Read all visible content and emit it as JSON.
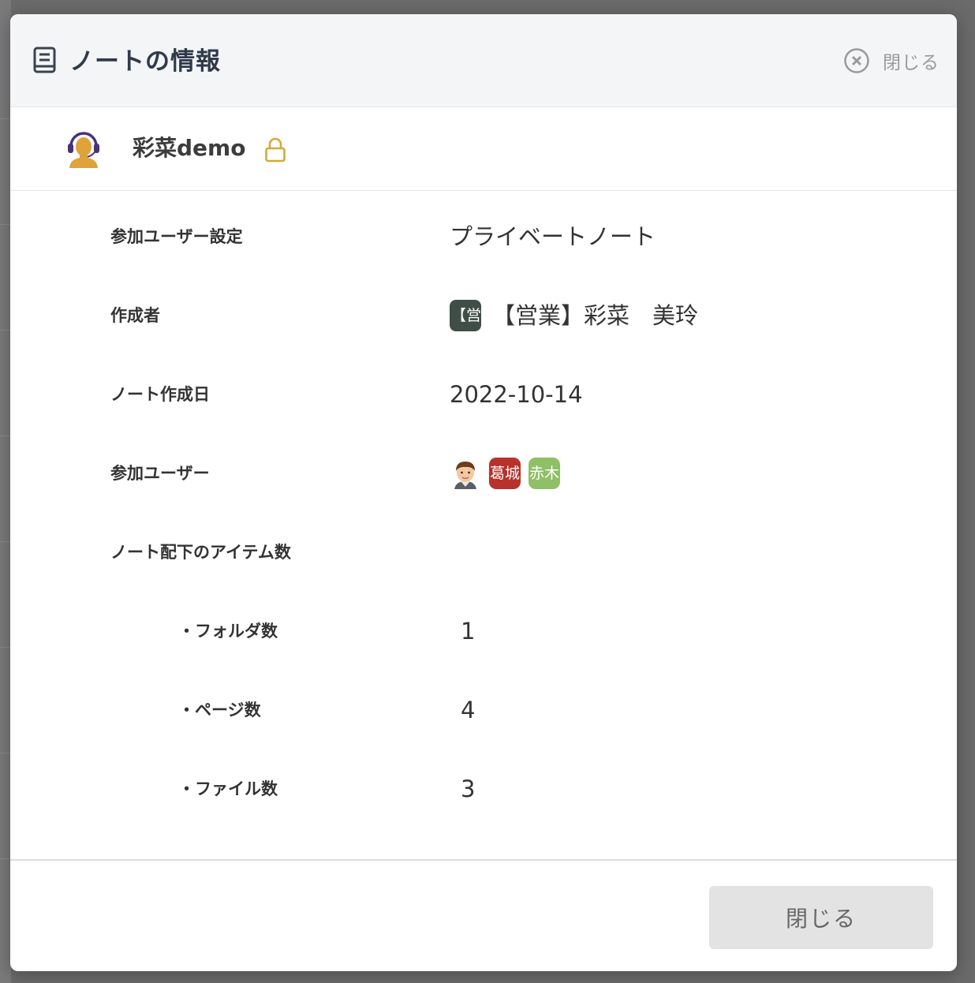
{
  "modal": {
    "title": "ノートの情報",
    "close_label": "閉じる",
    "footer_close_label": "閉じる"
  },
  "owner": {
    "name": "彩菜demo"
  },
  "info": {
    "participant_setting": {
      "label": "参加ユーザー設定",
      "value": "プライベートノート"
    },
    "creator": {
      "label": "作成者",
      "badge_text": "【営",
      "value": "【営業】彩菜　美玲"
    },
    "created_date": {
      "label": "ノート作成日",
      "value": "2022-10-14"
    },
    "participants": {
      "label": "参加ユーザー",
      "users": [
        {
          "type": "face-icon"
        },
        {
          "type": "chip",
          "text": "葛城",
          "color": "#b8312a"
        },
        {
          "type": "chip",
          "text": "赤木",
          "color": "#8fbf67"
        }
      ]
    },
    "items": {
      "label": "ノート配下のアイテム数"
    },
    "folders": {
      "label": "・フォルダ数",
      "value": "1"
    },
    "pages": {
      "label": "・ページ数",
      "value": "4"
    },
    "files": {
      "label": "・ファイル数",
      "value": "3"
    }
  },
  "colors": {
    "header_bg": "#f4f5f7",
    "lock_icon": "#d4a93a",
    "avatar": "#e0a23a",
    "headset": "#4a2f7a",
    "creator_badge": "#3f4f48"
  }
}
